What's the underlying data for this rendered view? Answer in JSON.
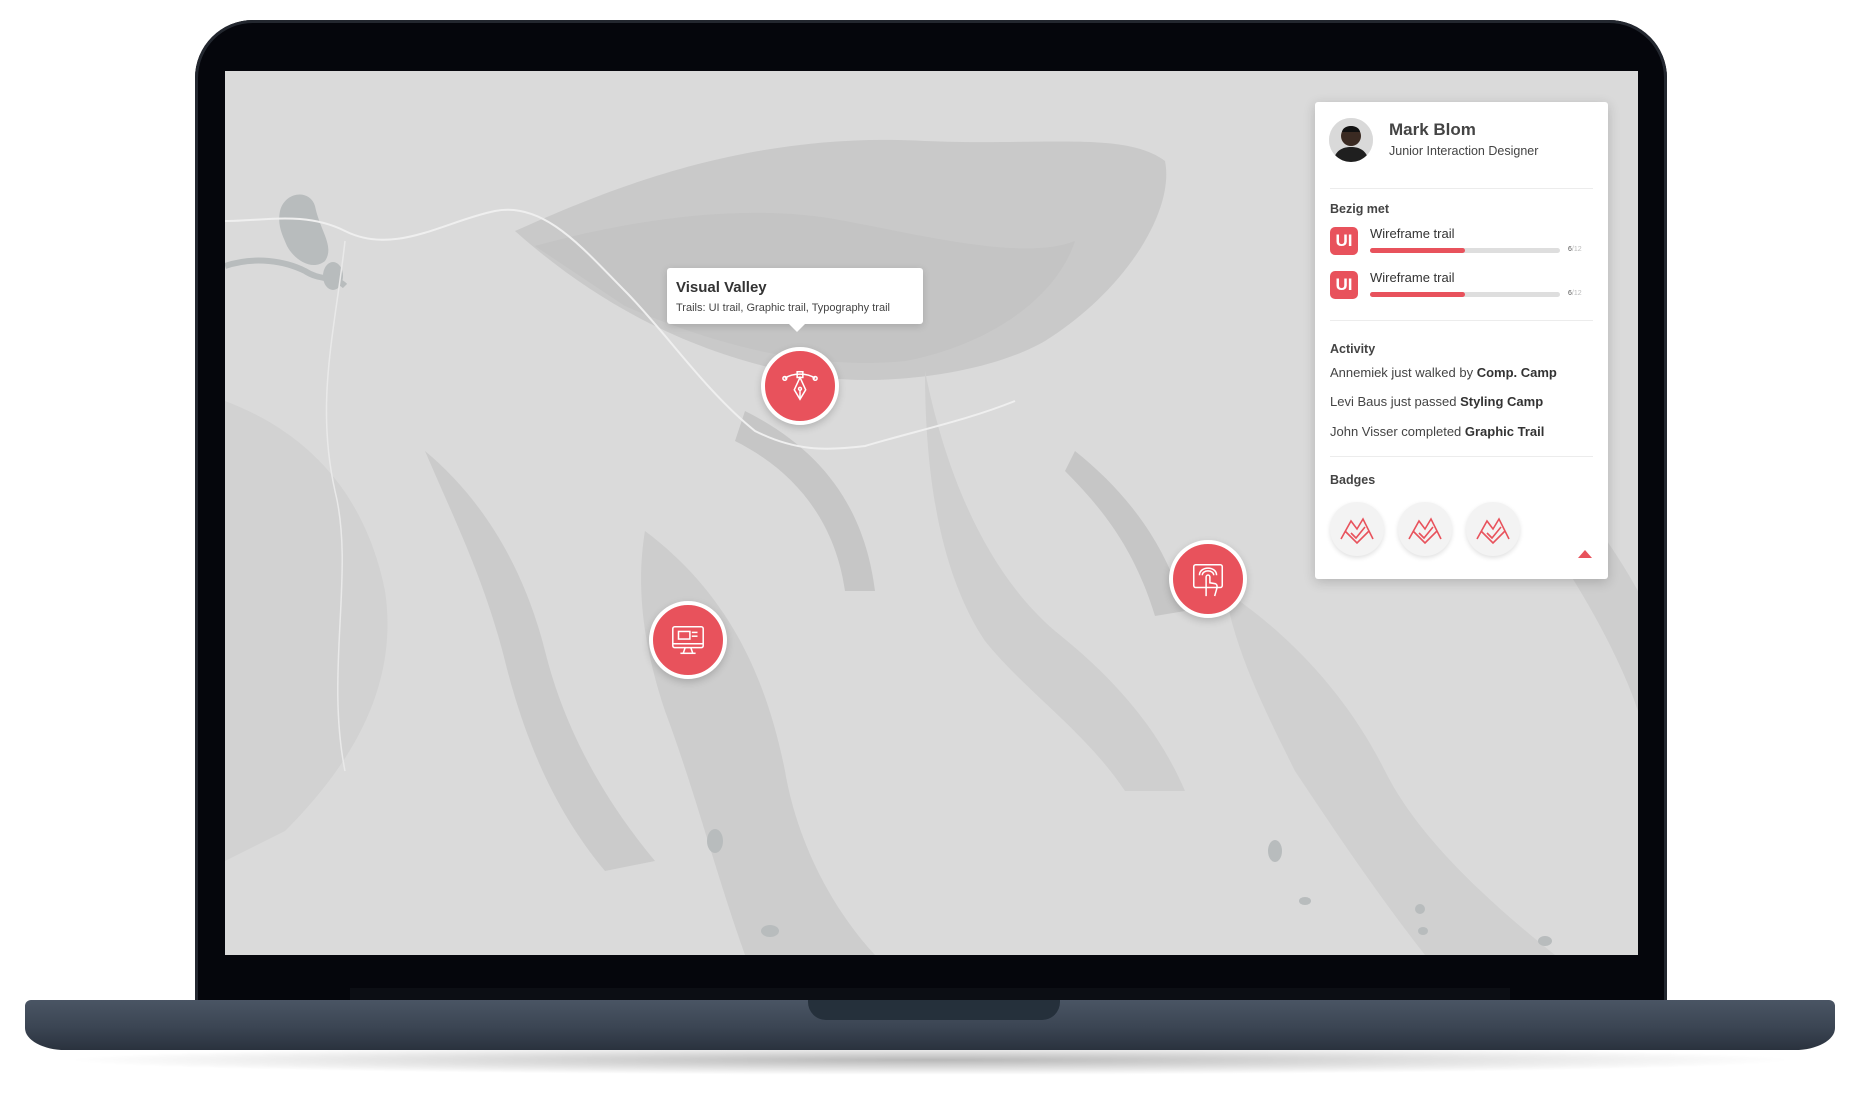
{
  "map": {
    "tooltip": {
      "title": "Visual Valley",
      "subtitle": "Trails: UI trail, Graphic trail, Typography trail"
    },
    "markers": [
      {
        "name": "visual-valley-marker",
        "icon": "pen-tool-icon"
      },
      {
        "name": "screen-marker",
        "icon": "monitor-icon"
      },
      {
        "name": "touch-marker",
        "icon": "touch-screen-icon"
      }
    ]
  },
  "panel": {
    "user": {
      "name": "Mark Blom",
      "role": "Junior Interaction Designer"
    },
    "busy": {
      "title": "Bezig met",
      "items": [
        {
          "badge": "UI",
          "name": "Wireframe trail",
          "done": "6",
          "total": "/12",
          "progress": 0.5
        },
        {
          "badge": "UI",
          "name": "Wireframe trail",
          "done": "6",
          "total": "/12",
          "progress": 0.5
        }
      ]
    },
    "activity": {
      "title": "Activity",
      "items": [
        {
          "text": "Annemiek just walked by ",
          "bold": "Comp. Camp"
        },
        {
          "text": "Levi Baus just passed ",
          "bold": "Styling Camp"
        },
        {
          "text": "John Visser completed ",
          "bold": "Graphic Trail"
        }
      ]
    },
    "badges": {
      "title": "Badges",
      "icons": [
        "mountain-check-icon",
        "mountain-check-icon",
        "mountain-check-icon"
      ]
    }
  },
  "colors": {
    "accent": "#e8525c",
    "map_base": "#dcdcdc",
    "laptop_body": "#3b4553"
  }
}
